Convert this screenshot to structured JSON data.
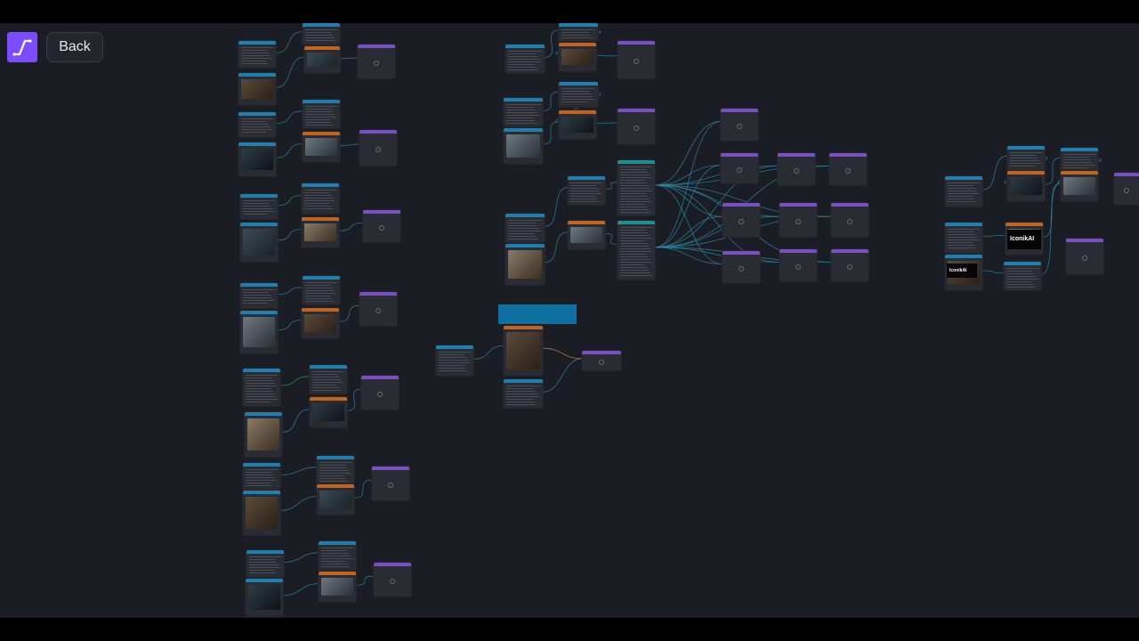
{
  "toolbar": {
    "back_label": "Back"
  },
  "logo": {
    "icon": "iconik-logo-icon",
    "color": "#7c4dff"
  },
  "canvas": {
    "thumbnail_brand_text": "IconikAI",
    "thumbnail_brand_text_small": "IconikAI",
    "colors": {
      "header_blue": "#1e7fb0",
      "header_orange": "#c0641e",
      "header_purple": "#7b4fc4",
      "header_teal": "#1e8f8f",
      "wire": "#2f8aa8",
      "wire_orange": "#c0641e"
    }
  }
}
